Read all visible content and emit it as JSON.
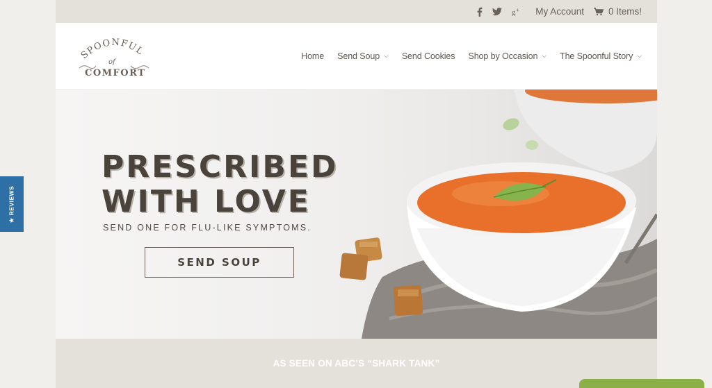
{
  "topbar": {
    "social_icons": [
      "facebook-icon",
      "twitter-icon",
      "google-plus-icon"
    ],
    "account_label": "My Account",
    "cart_label": "0 Items!"
  },
  "logo": {
    "line1": "SPOONFUL",
    "line2": "of",
    "line3": "COMFORT"
  },
  "nav": {
    "items": [
      {
        "label": "Home",
        "has_dropdown": false
      },
      {
        "label": "Send Soup",
        "has_dropdown": true
      },
      {
        "label": "Send Cookies",
        "has_dropdown": false
      },
      {
        "label": "Shop by Occasion",
        "has_dropdown": true
      },
      {
        "label": "The Spoonful Story",
        "has_dropdown": true
      }
    ]
  },
  "hero": {
    "headline1": "PRESCRIBED",
    "headline2": "WITH LOVE",
    "subhead": "SEND ONE FOR FLU-LIKE SYMPTOMS.",
    "cta_label": "SEND SOUP"
  },
  "banner": {
    "text": "AS SEEN ON ABC’S “SHARK TANK”"
  },
  "reviews_tab": {
    "label": "★ REVIEWS"
  },
  "colors": {
    "topbar_bg": "#e4e0da",
    "text_brown": "#4a433c",
    "reviews_blue": "#2e6fa6",
    "soup_orange": "#e8702a",
    "chat_green": "#8bb047"
  }
}
